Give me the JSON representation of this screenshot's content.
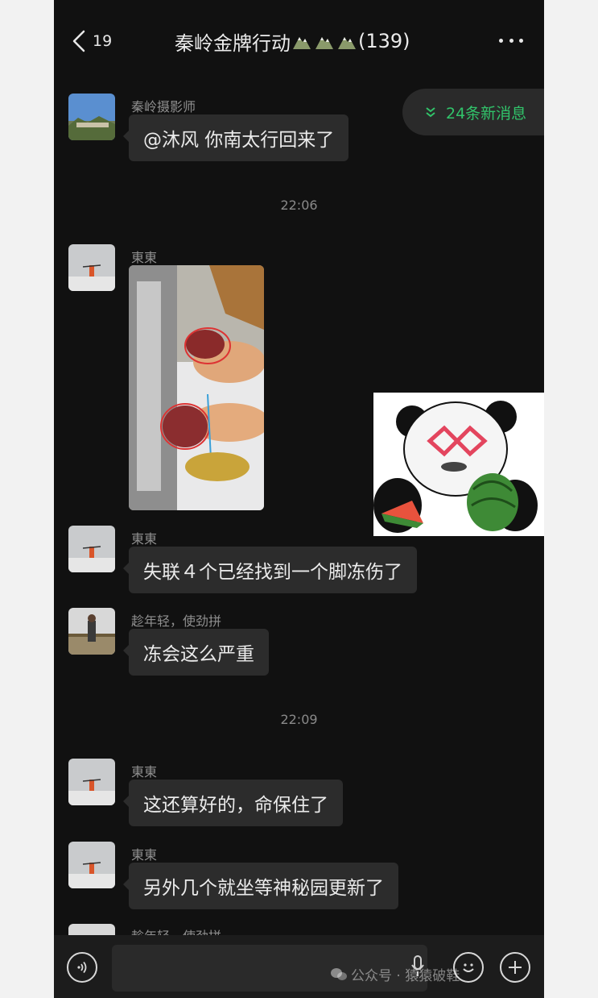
{
  "header": {
    "unread_count": "19",
    "title": "秦岭金牌行动",
    "member_count": "(139)"
  },
  "new_messages": "24条新消息",
  "messages": [
    {
      "sender": "秦岭摄影师",
      "text": "@沐风  你南太行回来了"
    },
    {
      "time": "22:06"
    },
    {
      "sender": "東東"
    },
    {
      "sender": "東東",
      "text": "失联４个已经找到一个脚冻伤了"
    },
    {
      "sender": "趁年轻，使劲拼",
      "text": "冻会这么严重"
    },
    {
      "time": "22:09"
    },
    {
      "sender": "東東",
      "text": "这还算好的，命保住了"
    },
    {
      "sender": "東東",
      "text": "另外几个就坐等神秘园更新了"
    },
    {
      "sender": "趁年轻，使劲拼"
    }
  ],
  "watermark": "公众号 · 猿猿破鞋",
  "colors": {
    "bg": "#111111",
    "bubble": "#2c2c2c",
    "accent": "#31c36a"
  }
}
